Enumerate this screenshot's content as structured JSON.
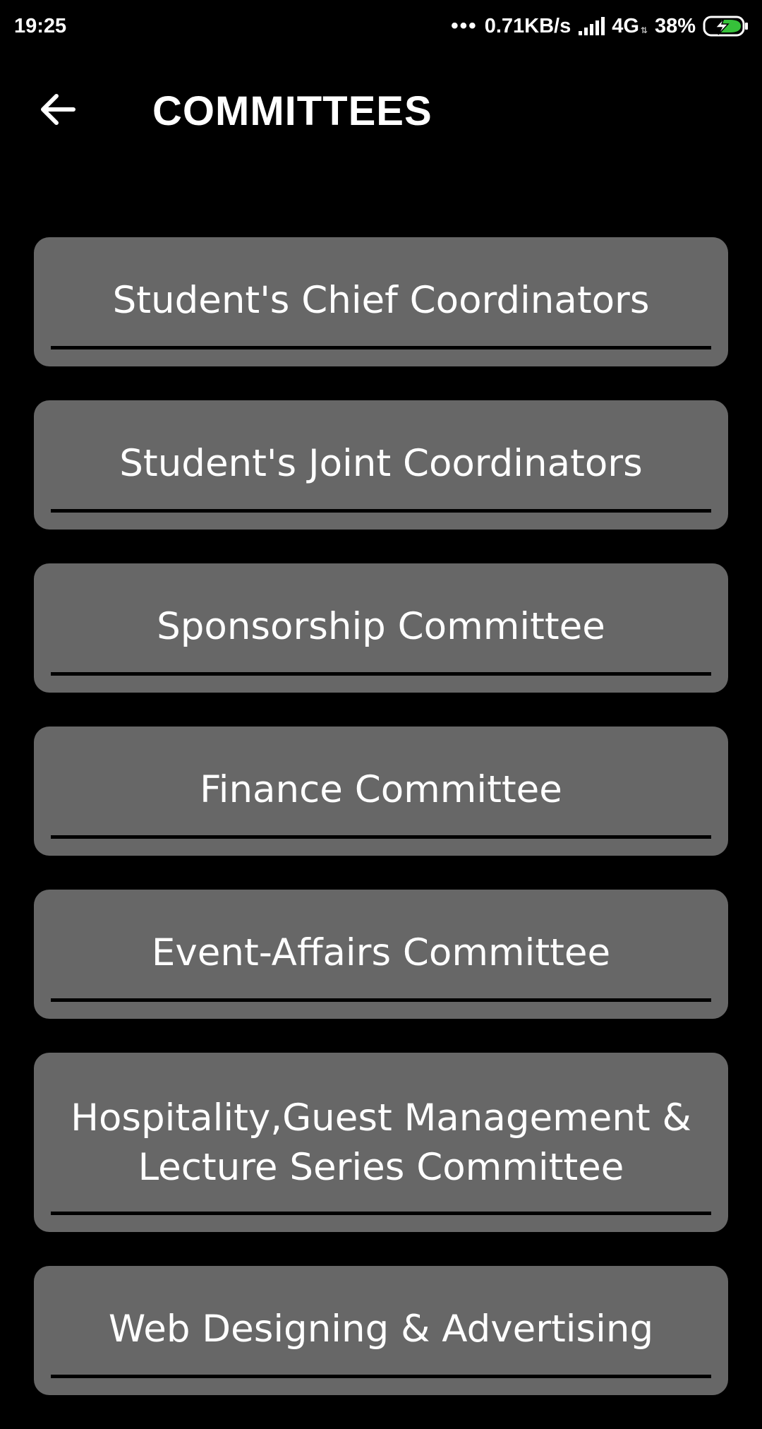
{
  "status_bar": {
    "time": "19:25",
    "dots": "•••",
    "net_speed": "0.71KB/s",
    "network": "4G",
    "battery": "38%"
  },
  "app_bar": {
    "back_icon": "arrow-left-icon",
    "title": "COMMITTEES"
  },
  "committees": [
    {
      "label": "Student's Chief Coordinators"
    },
    {
      "label": "Student's Joint Coordinators"
    },
    {
      "label": "Sponsorship Committee"
    },
    {
      "label": "Finance Committee"
    },
    {
      "label": "Event-Affairs Committee"
    },
    {
      "label": "Hospitality,Guest Management & Lecture Series Committee"
    },
    {
      "label": "Web Designing & Advertising"
    }
  ],
  "colors": {
    "background": "#000000",
    "card": "#676767",
    "text": "#ffffff",
    "battery_charging": "#36c13a"
  }
}
